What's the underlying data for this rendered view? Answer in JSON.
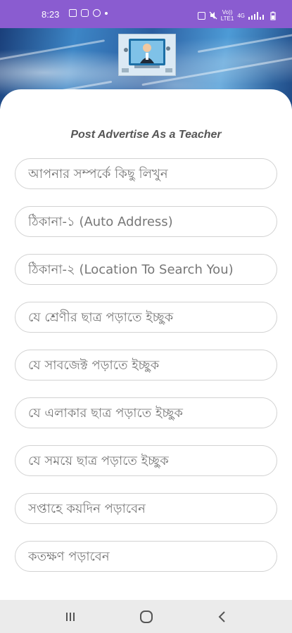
{
  "status_bar": {
    "time": "8:23",
    "network_top": "Vo))",
    "network_mid": "4G",
    "network_bottom": "LTE1"
  },
  "header": {
    "logo_icon": "teacher-classroom-logo"
  },
  "form": {
    "title": "Post Advertise As a Teacher",
    "fields": [
      {
        "placeholder": "আপনার সম্পর্কে কিছু লিখুন"
      },
      {
        "placeholder": "ঠিকানা-১ (Auto Address)"
      },
      {
        "placeholder": "ঠিকানা-২ (Location To Search You)"
      },
      {
        "placeholder": "যে শ্রেণীর ছাত্র পড়াতে ইচ্ছুক"
      },
      {
        "placeholder": "যে সাবজেক্ট পড়াতে ইচ্ছুক"
      },
      {
        "placeholder": "যে এলাকার ছাত্র পড়াতে ইচ্ছুক"
      },
      {
        "placeholder": "যে সময়ে ছাত্র পড়াতে ইচ্ছুক"
      },
      {
        "placeholder": "সপ্তাহে কয়দিন পড়াবেন"
      },
      {
        "placeholder": "কতক্ষণ পড়াবেন"
      }
    ]
  },
  "nav": {
    "recents_icon": "recent-apps-icon",
    "home_icon": "home-icon",
    "back_icon": "back-icon"
  },
  "colors": {
    "status_bar": "#8a5cd0",
    "field_border": "#d2d2d2",
    "title": "#555555"
  }
}
